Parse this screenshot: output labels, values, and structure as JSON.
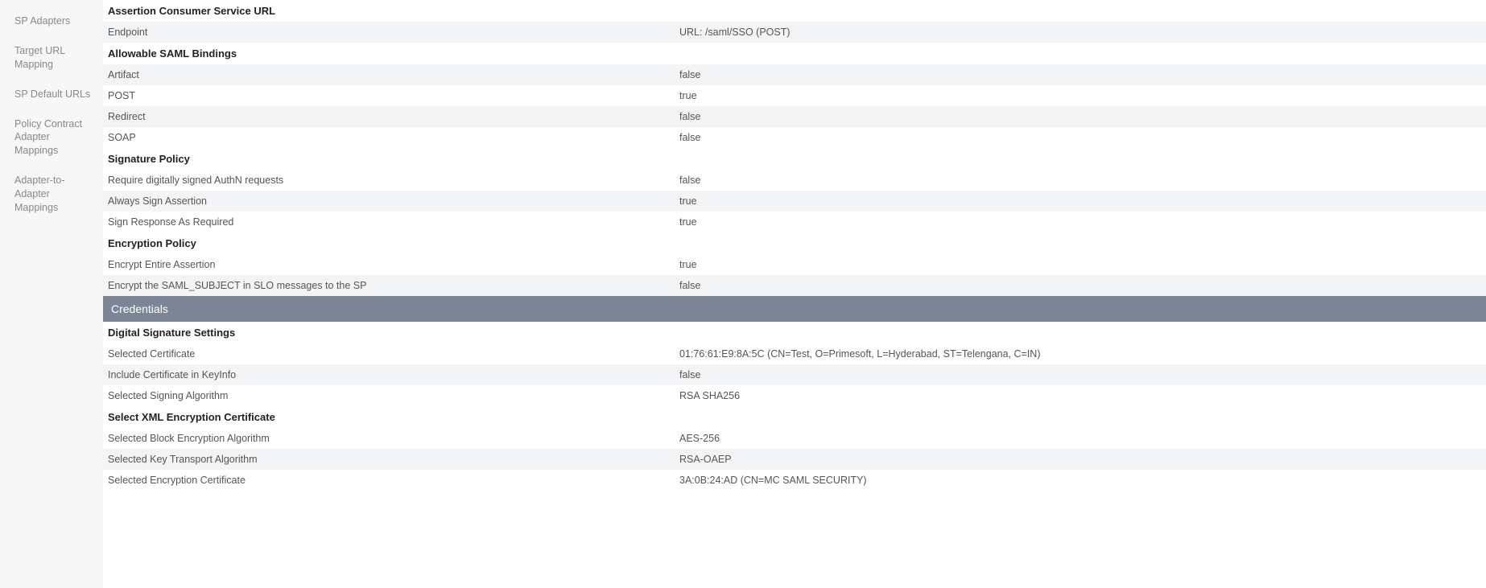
{
  "sidebar": {
    "items": [
      {
        "label": "SP Adapters"
      },
      {
        "label": "Target URL Mapping"
      },
      {
        "label": "SP Default URLs"
      },
      {
        "label": "Policy Contract Adapter Mappings"
      },
      {
        "label": "Adapter-to-Adapter Mappings"
      }
    ]
  },
  "sections": {
    "acs": {
      "heading": "Assertion Consumer Service URL",
      "endpoint_label": "Endpoint",
      "endpoint_value": "URL: /saml/SSO (POST)"
    },
    "bindings": {
      "heading": "Allowable SAML Bindings",
      "artifact_label": "Artifact",
      "artifact_value": "false",
      "post_label": "POST",
      "post_value": "true",
      "redirect_label": "Redirect",
      "redirect_value": "false",
      "soap_label": "SOAP",
      "soap_value": "false"
    },
    "sigpolicy": {
      "heading": "Signature Policy",
      "req_signed_label": "Require digitally signed AuthN requests",
      "req_signed_value": "false",
      "always_sign_label": "Always Sign Assertion",
      "always_sign_value": "true",
      "sign_resp_label": "Sign Response As Required",
      "sign_resp_value": "true"
    },
    "encpolicy": {
      "heading": "Encryption Policy",
      "encrypt_entire_label": "Encrypt Entire Assertion",
      "encrypt_entire_value": "true",
      "encrypt_subj_label": "Encrypt the SAML_SUBJECT in SLO messages to the SP",
      "encrypt_subj_value": "false"
    },
    "credentials_band": "Credentials",
    "digsig": {
      "heading": "Digital Signature Settings",
      "sel_cert_label": "Selected Certificate",
      "sel_cert_value": "01:76:61:E9:8A:5C (CN=Test, O=Primesoft, L=Hyderabad, ST=Telengana, C=IN)",
      "inc_cert_label": "Include Certificate in KeyInfo",
      "inc_cert_value": "false",
      "sel_alg_label": "Selected Signing Algorithm",
      "sel_alg_value": "RSA SHA256"
    },
    "xmlenc": {
      "heading": "Select XML Encryption Certificate",
      "block_label": "Selected Block Encryption Algorithm",
      "block_value": "AES-256",
      "key_trans_label": "Selected Key Transport Algorithm",
      "key_trans_value": "RSA-OAEP",
      "enc_cert_label": "Selected Encryption Certificate",
      "enc_cert_value": "3A:0B:24:AD (CN=MC SAML SECURITY)"
    }
  }
}
